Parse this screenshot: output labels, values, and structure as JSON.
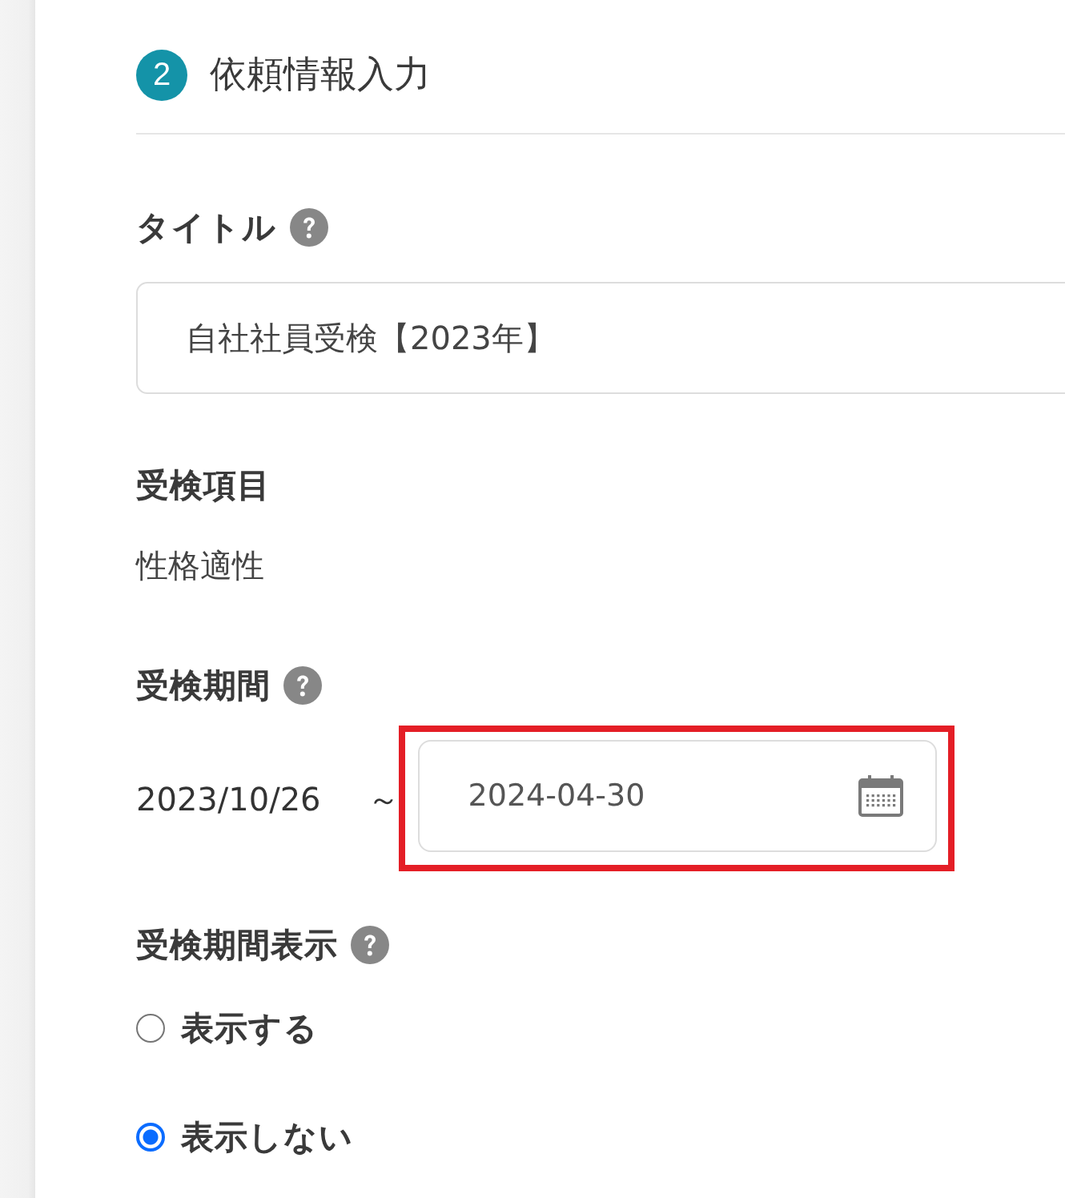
{
  "section": {
    "step": "2",
    "title": "依頼情報入力"
  },
  "fields": [
    {
      "kind": "text_input",
      "label": "タイトル",
      "help": true,
      "value": "自社社員受検【2023年】"
    },
    {
      "kind": "static",
      "label": "受検項目",
      "help": false,
      "value": "性格適性"
    },
    {
      "kind": "date_range",
      "label": "受検期間",
      "help": true,
      "start": "2023/10/26",
      "separator": "～",
      "end_value": "2024-04-30",
      "highlighted": true
    },
    {
      "kind": "radio_group",
      "label": "受検期間表示",
      "help": true,
      "options": [
        {
          "label": "表示する",
          "selected": false
        },
        {
          "label": "表示しない",
          "selected": true
        }
      ]
    }
  ]
}
